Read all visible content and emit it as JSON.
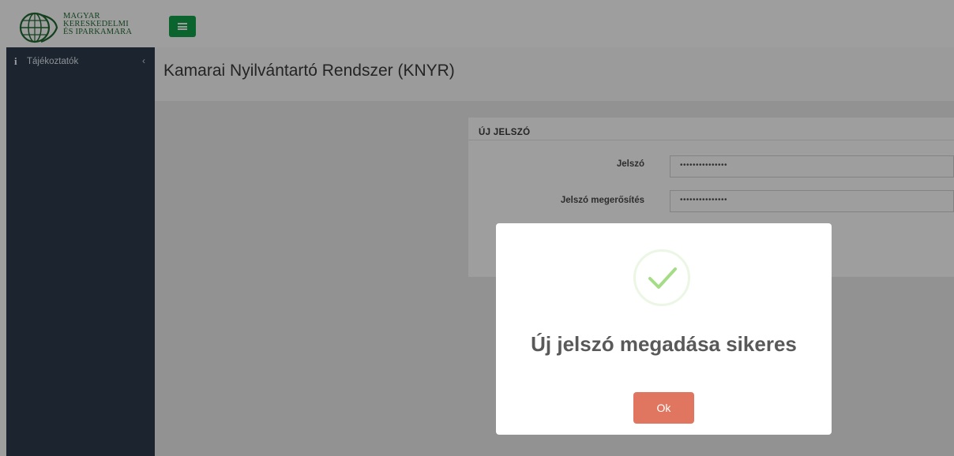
{
  "brand": {
    "line1": "MAGYAR",
    "line2": "KERESKEDELMI",
    "line3": "ÉS IPARKAMARA",
    "color": "#1f6a31"
  },
  "topbar": {
    "menu_icon": "hamburger-icon",
    "menu_color": "#12a04a"
  },
  "sidebar": {
    "items": [
      {
        "label": "Tájékoztatók",
        "icon": "info-icon",
        "chevron": "‹"
      }
    ],
    "background": "#2c3b4d"
  },
  "header": {
    "title": "Kamarai Nyilvántartó Rendszer (KNYR)"
  },
  "panel": {
    "title": "ÚJ JELSZÓ",
    "fields": [
      {
        "label": "Jelszó",
        "value": "•••••••••••••••"
      },
      {
        "label": "Jelszó megerősítés",
        "value": "•••••••••••••••"
      }
    ]
  },
  "modal": {
    "icon": "success-check-icon",
    "title": "Új jelszó megadása sikeres",
    "ok_label": "Ok",
    "ok_color": "#e17660"
  }
}
